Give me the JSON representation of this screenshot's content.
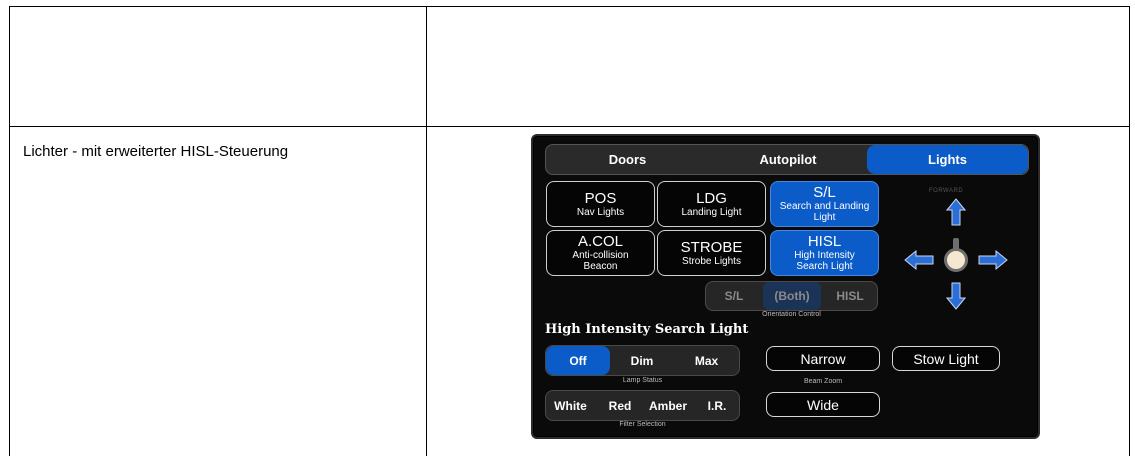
{
  "document": {
    "row_label": "Lichter - mit erweiterter HISL-Steuerung"
  },
  "tabs": [
    {
      "label": "Doors",
      "active": false
    },
    {
      "label": "Autopilot",
      "active": false
    },
    {
      "label": "Lights",
      "active": true
    }
  ],
  "lights": [
    {
      "main": "POS",
      "sub": "Nav Lights",
      "active": false
    },
    {
      "main": "LDG",
      "sub": "Landing Light",
      "active": false
    },
    {
      "main": "S/L",
      "sub": "Search and Landing Light",
      "active": true
    },
    {
      "main": "A.COL",
      "sub": "Anti-collision Beacon",
      "active": false
    },
    {
      "main": "STROBE",
      "sub": "Strobe Lights",
      "active": false
    },
    {
      "main": "HISL",
      "sub": "High Intensity Search Light",
      "active": true
    }
  ],
  "orientation": {
    "options": [
      "S/L",
      "(Both)",
      "HISL"
    ],
    "selected": "(Both)",
    "caption": "Orientation Control"
  },
  "compass": {
    "label": "FORWARD"
  },
  "hisl": {
    "title": "High Intensity Search Light",
    "lamp": {
      "options": [
        "Off",
        "Dim",
        "Max"
      ],
      "selected": "Off",
      "caption": "Lamp Status"
    },
    "filter": {
      "options": [
        "White",
        "Red",
        "Amber",
        "I.R."
      ],
      "caption": "Filter Selection"
    },
    "beam": {
      "narrow": "Narrow",
      "wide": "Wide",
      "caption": "Beam Zoom"
    },
    "stow": "Stow Light"
  },
  "colors": {
    "accent": "#0b5cc8",
    "panel_bg": "#0a0a0a"
  }
}
